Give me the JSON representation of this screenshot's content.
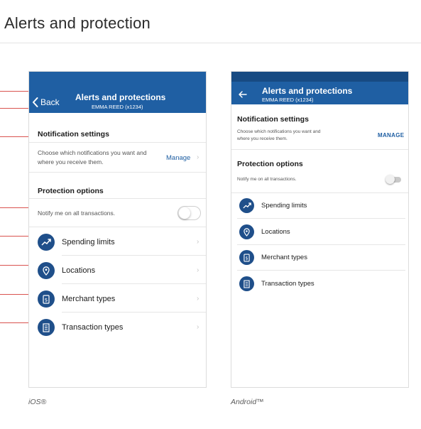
{
  "page": {
    "title": "Alerts and protection"
  },
  "ios": {
    "caption": "iOS®",
    "header": {
      "back_label": "Back",
      "title": "Alerts and protections",
      "subtitle": "EMMA REED (x1234)"
    },
    "notification": {
      "title": "Notification settings",
      "description": "Choose which notifications you want and where you receive them.",
      "action": "Manage"
    },
    "protection": {
      "title": "Protection options",
      "toggle_label": "Notify me on all transactions.",
      "toggle_on": false
    },
    "rows": [
      {
        "label": "Spending limits",
        "icon": "trend-up-icon"
      },
      {
        "label": "Locations",
        "icon": "location-pin-icon"
      },
      {
        "label": "Merchant types",
        "icon": "merchant-receipt-icon"
      },
      {
        "label": "Transaction types",
        "icon": "transaction-document-icon"
      }
    ]
  },
  "android": {
    "caption": "Android™",
    "header": {
      "title": "Alerts and protections",
      "subtitle": "EMMA REED (x1234)"
    },
    "notification": {
      "title": "Notification settings",
      "description": "Choose which notifications you want and where you receive them.",
      "action": "MANAGE"
    },
    "protection": {
      "title": "Protection options",
      "toggle_label": "Notify me on all transactions.",
      "toggle_on": false
    },
    "rows": [
      {
        "label": "Spending limits",
        "icon": "trend-up-icon"
      },
      {
        "label": "Locations",
        "icon": "location-pin-icon"
      },
      {
        "label": "Merchant types",
        "icon": "merchant-receipt-icon"
      },
      {
        "label": "Transaction types",
        "icon": "transaction-document-icon"
      }
    ]
  },
  "colors": {
    "header_blue": "#1f5fa3",
    "icon_blue": "#1f4f8a",
    "callout_red": "#d9534f",
    "link_blue": "#1f5fa3"
  }
}
